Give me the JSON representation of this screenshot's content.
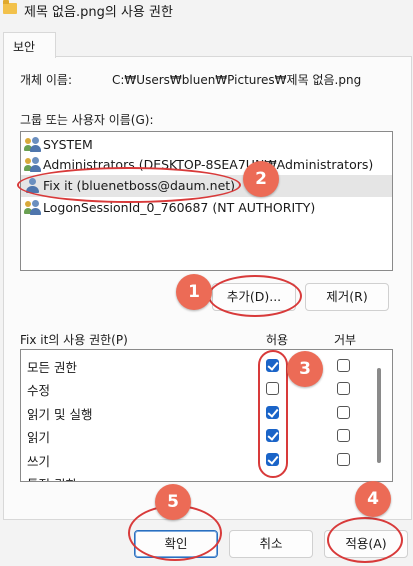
{
  "window": {
    "title": "제목 없음.png의 사용 권한"
  },
  "tabs": [
    {
      "label": "보안"
    }
  ],
  "object": {
    "label": "개체 이름:",
    "value": "C:₩Users₩bluen₩Pictures₩제목 없음.png"
  },
  "groups": {
    "label": "그룹 또는 사용자 이름(G):",
    "items": [
      {
        "label": "SYSTEM",
        "icon": "group-users-icon"
      },
      {
        "label": "Administrators (DESKTOP-8SEA7UN₩Administrators)",
        "icon": "group-users-icon"
      },
      {
        "label": "Fix it (bluenetboss@daum.net)",
        "icon": "user-icon",
        "selected": true
      },
      {
        "label": "LogonSessionId_0_760687 (NT AUTHORITY)",
        "icon": "group-users-icon"
      }
    ]
  },
  "buttons": {
    "add": "추가(D)...",
    "remove": "제거(R)",
    "ok": "확인",
    "cancel": "취소",
    "apply": "적용(A)"
  },
  "permissions": {
    "label": "Fix it의 사용 권한(P)",
    "allow_header": "허용",
    "deny_header": "거부",
    "rows": [
      {
        "name": "모든 권한",
        "allow": true,
        "deny": false
      },
      {
        "name": "수정",
        "allow": false,
        "deny": false
      },
      {
        "name": "읽기 및 실행",
        "allow": true,
        "deny": false
      },
      {
        "name": "읽기",
        "allow": true,
        "deny": false
      },
      {
        "name": "쓰기",
        "allow": true,
        "deny": false
      },
      {
        "name": "특정 권한",
        "allow": false,
        "deny": false
      }
    ]
  },
  "annotations": [
    "1",
    "2",
    "3",
    "4",
    "5"
  ],
  "colors": {
    "accent": "#1a64c8",
    "annotation": "#ec6b56",
    "ring": "#d83a3a"
  }
}
